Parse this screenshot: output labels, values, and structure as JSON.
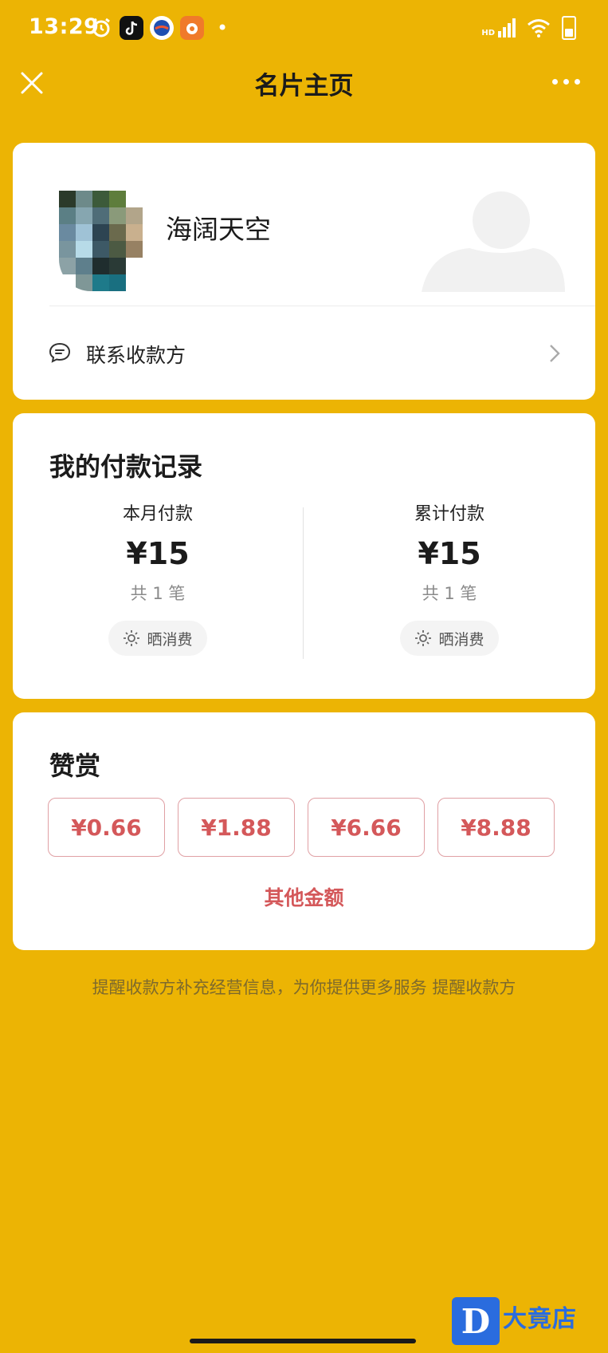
{
  "status_bar": {
    "time": "13:29",
    "network_label": "HD"
  },
  "header": {
    "title": "名片主页"
  },
  "profile": {
    "name": "海阔天空",
    "contact_label": "联系收款方"
  },
  "payment_records": {
    "title": "我的付款记录",
    "monthly": {
      "label": "本月付款",
      "amount": "¥15",
      "count": "共 1 笔",
      "share_label": "晒消费"
    },
    "total": {
      "label": "累计付款",
      "amount": "¥15",
      "count": "共 1 笔",
      "share_label": "晒消费"
    }
  },
  "tips": {
    "title": "赞赏",
    "options": [
      "¥0.66",
      "¥1.88",
      "¥6.66",
      "¥8.88"
    ],
    "other_label": "其他金额"
  },
  "footer": {
    "message": "提醒收款方补充经营信息，为你提供更多服务",
    "link_label": "提醒收款方"
  },
  "watermark": {
    "logo_letter": "D",
    "text": "大竟店"
  },
  "colors": {
    "background": "#ecb404",
    "accent_red": "#d4585a",
    "card": "#ffffff"
  },
  "icons": [
    "alarm-icon",
    "tiktok-icon",
    "app-icon",
    "signal-icon",
    "wifi-icon",
    "battery-icon",
    "close-icon",
    "more-icon",
    "chat-icon",
    "chevron-right-icon",
    "sun-icon"
  ]
}
